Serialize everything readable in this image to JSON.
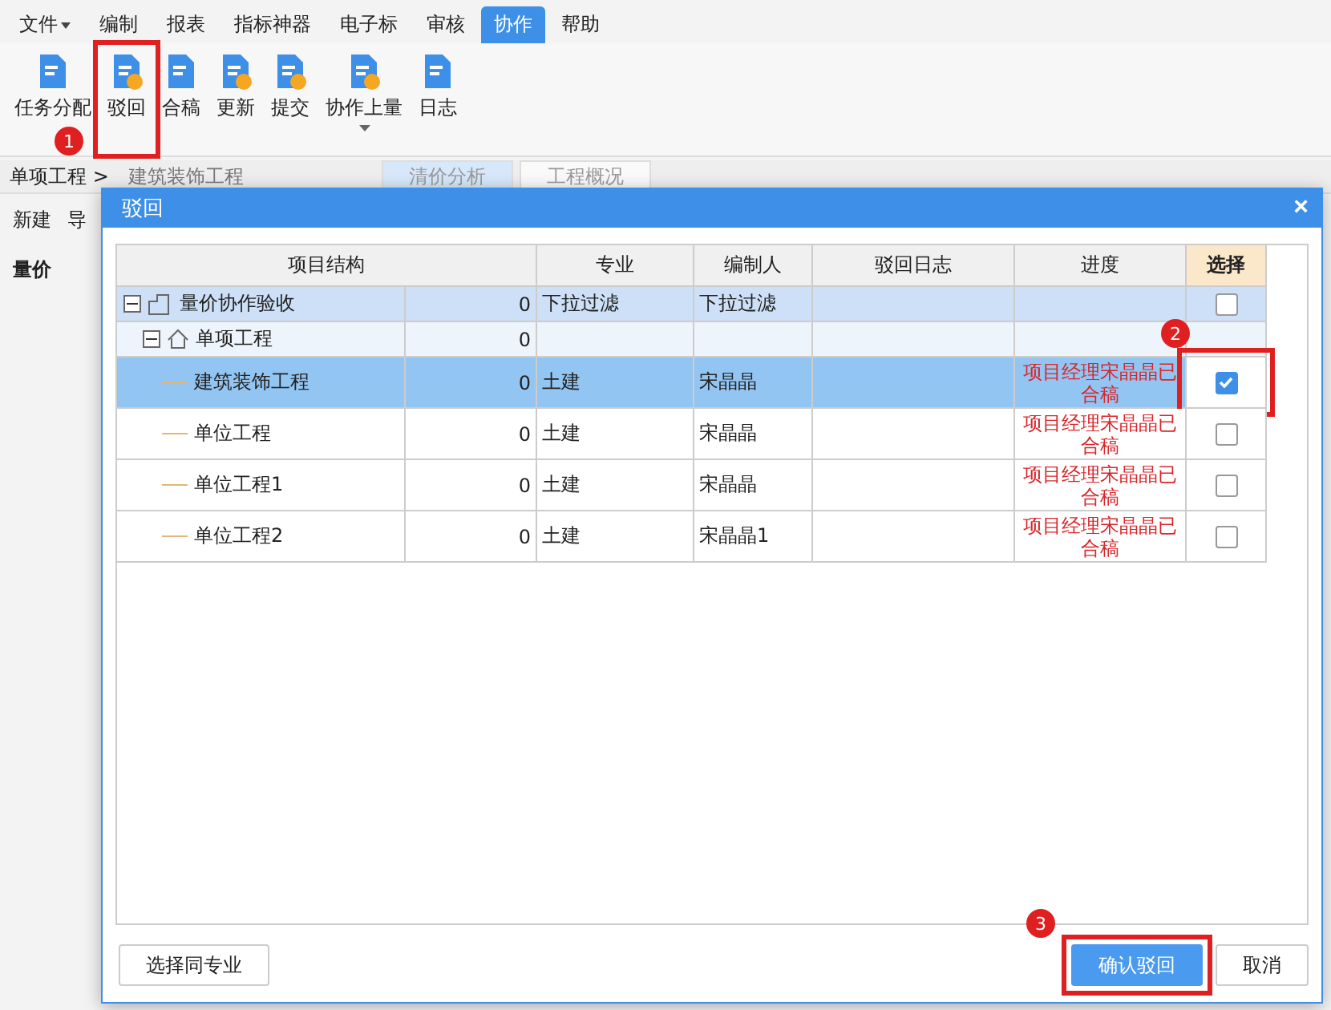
{
  "menu": [
    {
      "label": "文件",
      "dropdown": true,
      "selected": false
    },
    {
      "label": "编制",
      "dropdown": false,
      "selected": false
    },
    {
      "label": "报表",
      "dropdown": false,
      "selected": false
    },
    {
      "label": "指标神器",
      "dropdown": false,
      "selected": false
    },
    {
      "label": "电子标",
      "dropdown": false,
      "selected": false
    },
    {
      "label": "审核",
      "dropdown": false,
      "selected": false
    },
    {
      "label": "协作",
      "dropdown": false,
      "selected": true
    },
    {
      "label": "帮助",
      "dropdown": false,
      "selected": false
    }
  ],
  "toolbar": [
    {
      "label": "任务分配",
      "kind": "share"
    },
    {
      "label": "驳回",
      "kind": "reject",
      "callout": "1"
    },
    {
      "label": "合稿",
      "kind": "merge"
    },
    {
      "label": "更新",
      "kind": "update"
    },
    {
      "label": "提交",
      "kind": "submit"
    },
    {
      "label": "协作上量",
      "kind": "upload",
      "dropdown": true
    },
    {
      "label": "日志",
      "kind": "log"
    }
  ],
  "breadcrumb": {
    "path": "单项工程 >",
    "current": "建筑装饰工程"
  },
  "view_tabs": [
    {
      "label": "清价分析",
      "selected": true
    },
    {
      "label": "工程概况",
      "selected": false
    }
  ],
  "side_toolbar": [
    "新建",
    "导"
  ],
  "side_tree": {
    "label": "量价"
  },
  "dialog": {
    "title": "驳回",
    "close": "×",
    "columns": [
      "项目结构",
      "专业",
      "编制人",
      "驳回日志",
      "进度",
      "选择"
    ],
    "rows": [
      {
        "kind": "project",
        "name": "量价协作验收",
        "count": "0",
        "major": "下拉过滤",
        "author": "下拉过滤",
        "expanded": true,
        "checked": false,
        "selected": false,
        "children": [
          {
            "kind": "single",
            "name": "单项工程",
            "count": "0",
            "expanded": true,
            "selected": false,
            "children": [
              {
                "kind": "unit",
                "name": "建筑装饰工程",
                "count": "0",
                "major": "土建",
                "author": "宋晶晶",
                "progress": "项目经理宋晶晶已合稿",
                "checked": true,
                "selected": true,
                "callout": "2"
              },
              {
                "kind": "unit",
                "name": "单位工程",
                "count": "0",
                "major": "土建",
                "author": "宋晶晶",
                "progress": "项目经理宋晶晶已合稿",
                "checked": false,
                "selected": false
              },
              {
                "kind": "unit",
                "name": "单位工程1",
                "count": "0",
                "major": "土建",
                "author": "宋晶晶",
                "progress": "项目经理宋晶晶已合稿",
                "checked": false,
                "selected": false
              },
              {
                "kind": "unit",
                "name": "单位工程2",
                "count": "0",
                "major": "土建",
                "author": "宋晶晶1",
                "progress": "项目经理宋晶晶已合稿",
                "checked": false,
                "selected": false
              }
            ]
          }
        ]
      }
    ],
    "buttons": [
      {
        "label": "选择同专业",
        "kind": "plain"
      },
      {
        "label": "确认驳回",
        "kind": "primary",
        "callout": "3"
      },
      {
        "label": "取消",
        "kind": "plain"
      }
    ]
  }
}
